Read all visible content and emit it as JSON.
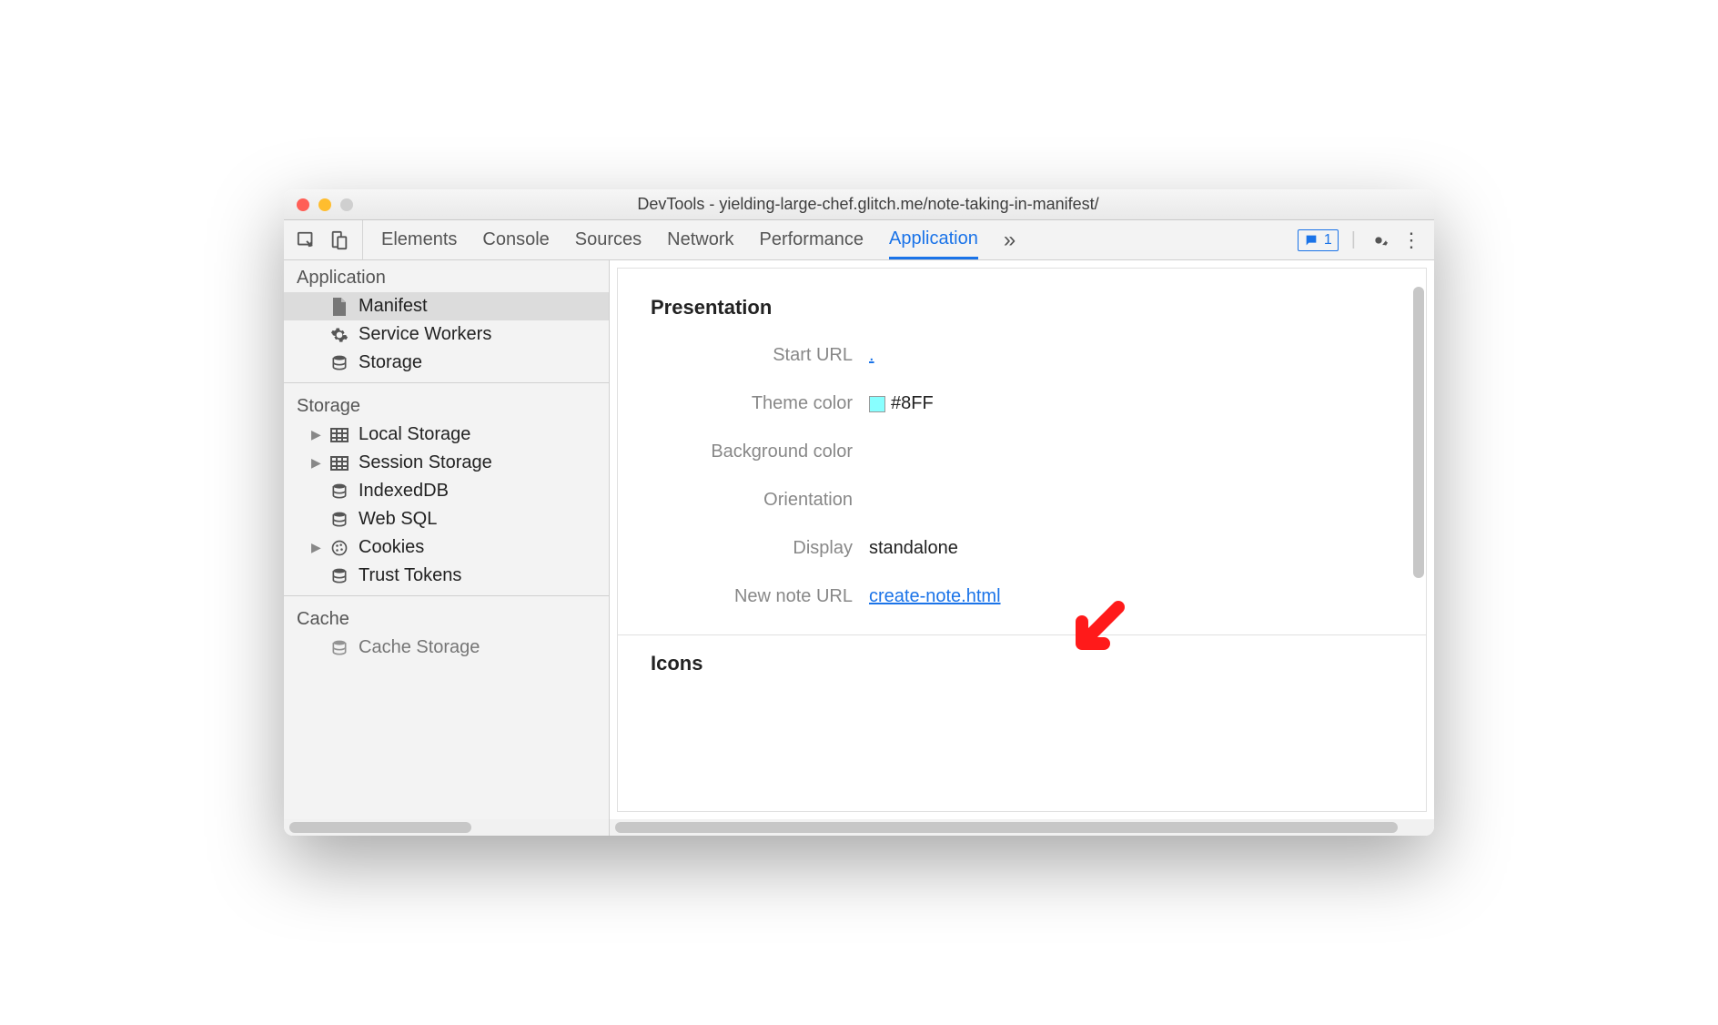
{
  "window": {
    "title": "DevTools - yielding-large-chef.glitch.me/note-taking-in-manifest/"
  },
  "tabs": {
    "items": [
      "Elements",
      "Console",
      "Sources",
      "Network",
      "Performance",
      "Application"
    ],
    "active": "Application",
    "overflow": "»",
    "badge_count": "1"
  },
  "sidebar": {
    "groups": [
      {
        "title": "Application",
        "items": [
          {
            "label": "Manifest",
            "icon": "doc",
            "selected": true
          },
          {
            "label": "Service Workers",
            "icon": "gear"
          },
          {
            "label": "Storage",
            "icon": "db"
          }
        ]
      },
      {
        "title": "Storage",
        "items": [
          {
            "label": "Local Storage",
            "icon": "grid",
            "expandable": true
          },
          {
            "label": "Session Storage",
            "icon": "grid",
            "expandable": true
          },
          {
            "label": "IndexedDB",
            "icon": "db"
          },
          {
            "label": "Web SQL",
            "icon": "db"
          },
          {
            "label": "Cookies",
            "icon": "cookie",
            "expandable": true
          },
          {
            "label": "Trust Tokens",
            "icon": "db"
          }
        ]
      },
      {
        "title": "Cache",
        "items": [
          {
            "label": "Cache Storage",
            "icon": "db"
          }
        ]
      }
    ]
  },
  "presentation": {
    "heading": "Presentation",
    "rows": {
      "start_url": {
        "label": "Start URL",
        "value": "."
      },
      "theme_color": {
        "label": "Theme color",
        "value": "#8FF",
        "swatch": "#88FFFF"
      },
      "background_color": {
        "label": "Background color",
        "value": ""
      },
      "orientation": {
        "label": "Orientation",
        "value": ""
      },
      "display": {
        "label": "Display",
        "value": "standalone"
      },
      "new_note_url": {
        "label": "New note URL",
        "value": "create-note.html"
      }
    },
    "icons_heading": "Icons"
  }
}
